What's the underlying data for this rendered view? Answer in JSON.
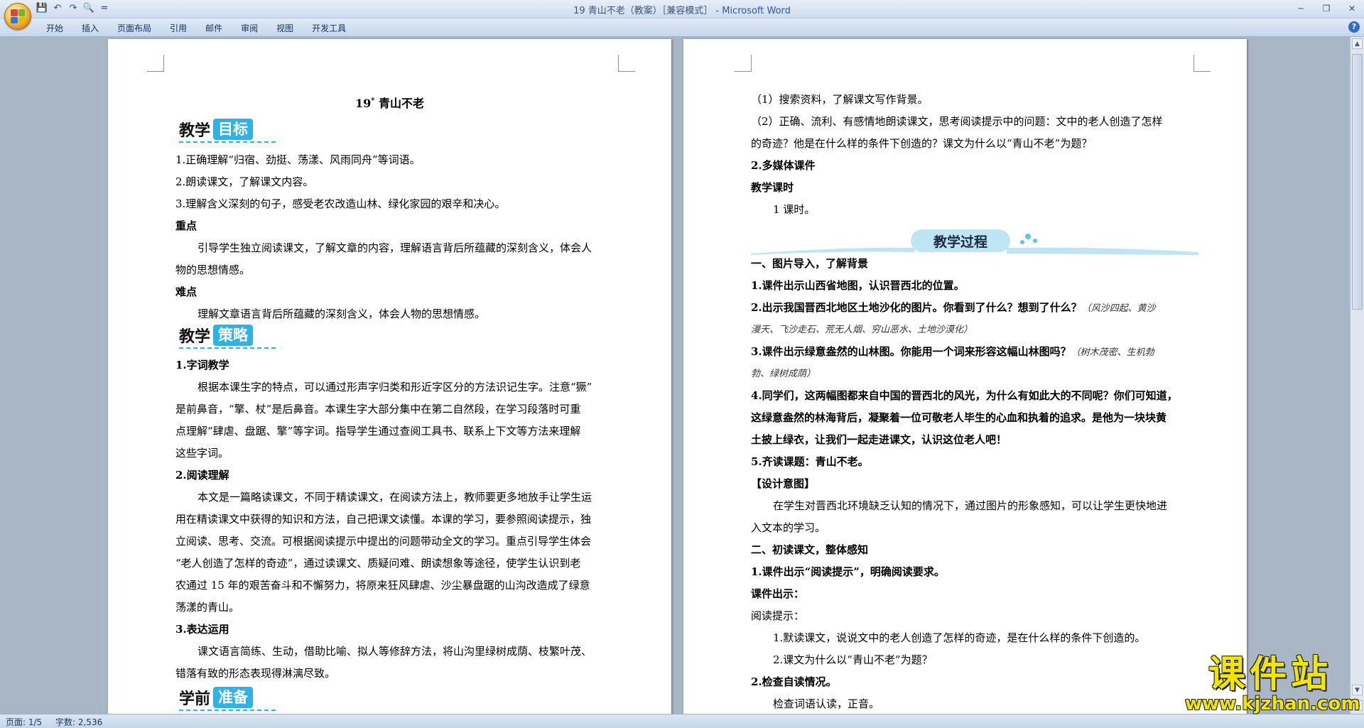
{
  "window": {
    "title_doc": "19 青山不老（教案）［兼容模式］",
    "title_sep": " - ",
    "title_app": "Microsoft Word"
  },
  "quick_access": {
    "more": "="
  },
  "ribbon": {
    "tabs": [
      "开始",
      "插入",
      "页面布局",
      "引用",
      "邮件",
      "审阅",
      "视图",
      "开发工具"
    ],
    "help": "?"
  },
  "status": {
    "page": "页面: 1/5",
    "words": "字数: 2,536"
  },
  "watermark": {
    "cn": "课件站",
    "url": "www.kjzhan.com"
  },
  "left_page": {
    "title_num": "19",
    "title_mark": "*",
    "title_text": "青山不老",
    "goals": {
      "k": "教学",
      "v": "目标"
    },
    "goal_items": [
      "1.正确理解“归宿、劲挺、荡漾、风雨同舟”等词语。",
      "2.朗读课文，了解课文内容。",
      "3.理解含义深刻的句子，感受老农改造山林、绿化家园的艰辛和决心。"
    ],
    "key_label": "重点",
    "key_text": [
      "引导学生独立阅读课文，了解文章的内容，理解语言背后所蕴藏的深刻含义，体会人",
      "物的思想情感。"
    ],
    "diff_label": "难点",
    "diff_text": "理解文章语言背后所蕴藏的深刻含义，体会人物的思想情感。",
    "strategy": {
      "k": "教学",
      "v": "策略"
    },
    "s1_label": "1.字词教学",
    "s1_text": [
      "根据本课生字的特点，可以通过形声字归类和形近字区分的方法识记生字。注意“獗”",
      "是前鼻音，“擎、杖”是后鼻音。本课生字大部分集中在第二自然段，在学习段落时可重",
      "点理解“肆虐、盘踞、擎”等字词。指导学生通过查阅工具书、联系上下文等方法来理解",
      "这些字词。"
    ],
    "s2_label": "2.阅读理解",
    "s2_text": [
      "本文是一篇略读课文，不同于精读课文，在阅读方法上，教师要更多地放手让学生运",
      "用在精读课文中获得的知识和方法，自己把课文读懂。本课的学习，要参照阅读提示，独",
      "立阅读、思考、交流。可根据阅读提示中提出的问题带动全文的学习。重点引导学生体会",
      "“老人创造了怎样的奇迹”，通过读课文、质疑问难、朗读想象等途径，使学生认识到老",
      "农通过 15 年的艰苦奋斗和不懈努力，将原来狂风肆虐、沙尘暴盘踞的山沟改造成了绿意",
      "荡漾的青山。"
    ],
    "s3_label": "3.表达运用",
    "s3_text": [
      "课文语言简练、生动，借助比喻、拟人等修辞方法，将山沟里绿树成荫、枝繁叶茂、",
      "错落有致的形态表现得淋漓尽致。"
    ],
    "prep": {
      "k": "学前",
      "v": "准备"
    }
  },
  "right_page": {
    "p1": "（1）搜索资料，了解课文写作背景。",
    "p2a": "（2）正确、流利、有感情地朗读课文，思考阅读提示中的问题：文中的老人创造了怎样",
    "p2b": "的奇迹？他是在什么样的条件下创造的？课文为什么以“青山不老”为题？",
    "p3": "2.多媒体课件",
    "p4": "教学课时",
    "p5": "1 课时。",
    "process_title": "教学过程",
    "h1": "一、图片导入，了解背景",
    "l1": "1.课件出示山西省地图，认识晋西北的位置。",
    "l2": "2.出示我国晋西北地区土地沙化的图片。你看到了什么？想到了什么？",
    "l2n_a": "（风沙四起、黄沙",
    "l2n_b": "漫天、飞沙走石、荒无人烟、穷山恶水、土地沙漠化）",
    "l3": "3.课件出示绿意盎然的山林图。你能用一个词来形容这幅山林图吗？",
    "l3n_a": "（树木茂密、生机勃",
    "l3n_b": "勃、绿树成荫）",
    "l4a": "4.同学们，这两幅图都来自中国的晋西北的风光，为什么有如此大的不同呢？你们可知道，",
    "l4b": "这绿意盎然的林海背后，凝聚着一位可敬老人毕生的心血和执着的追求。是他为一块块黄",
    "l4c": "土披上绿衣，让我们一起走进课文，认识这位老人吧！",
    "l5": "5.齐读课题：青山不老。",
    "design_label": "【设计意图】",
    "design_a": "在学生对晋西北环境缺乏认知的情况下，通过图片的形象感知，可以让学生更快地进",
    "design_b": "入文本的学习。",
    "h2": "二、初读课文，整体感知",
    "m1": "1.课件出示“阅读提示”，明确阅读要求。",
    "m2": "课件出示：",
    "m3": "阅读提示：",
    "m4": "1.默读课文，说说文中的老人创造了怎样的奇迹，是在什么样的条件下创造的。",
    "m5": "2.课文为什么以“青山不老”为题？",
    "m6": "2.检查自读情况。",
    "m7": "检查词语认读，正音。"
  },
  "colors": {
    "accent": "#2fb3e6",
    "watermark": "#f2e600"
  }
}
